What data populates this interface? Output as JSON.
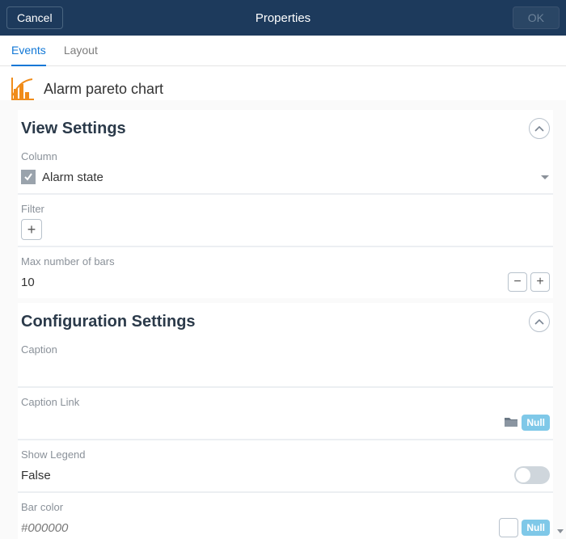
{
  "header": {
    "cancel": "Cancel",
    "title": "Properties",
    "ok": "OK"
  },
  "tabs": {
    "events": "Events",
    "layout": "Layout"
  },
  "object": {
    "title": "Alarm pareto chart"
  },
  "view_settings": {
    "heading": "View Settings",
    "column_label": "Column",
    "column_value": "Alarm state",
    "filter_label": "Filter",
    "max_bars_label": "Max number of bars",
    "max_bars_value": "10"
  },
  "config_settings": {
    "heading": "Configuration Settings",
    "caption_label": "Caption",
    "caption_value": "",
    "caption_link_label": "Caption Link",
    "caption_link_value": "",
    "null_label": "Null",
    "show_legend_label": "Show Legend",
    "show_legend_value": "False",
    "bar_color_label": "Bar color",
    "bar_color_value": "#000000"
  }
}
